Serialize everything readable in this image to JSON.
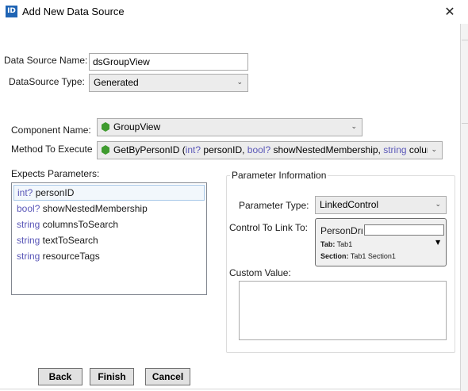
{
  "window": {
    "icon_text": "ID",
    "title": "Add New Data Source",
    "close_glyph": "✕"
  },
  "fields": {
    "data_source_name_label": "Data Source Name:",
    "data_source_name_value": "dsGroupView",
    "datasource_type_label": "DataSource Type:",
    "datasource_type_value": "Generated",
    "component_name_label": "Component Name:",
    "component_name_value": "GroupView",
    "method_label": "Method To Execute",
    "method_name": "GetByPersonID",
    "method_sig_open": " (",
    "method_p1_type": "int?",
    "method_p1_name": " personID, ",
    "method_p2_type": "bool?",
    "method_p2_name": " showNestedMembership, ",
    "method_p3_type": "string",
    "method_p3_name": " colur"
  },
  "expects_parameters": {
    "label": "Expects Parameters:",
    "items": [
      {
        "type": "int?",
        "name": " personID"
      },
      {
        "type": "bool?",
        "name": " showNestedMembership"
      },
      {
        "type": "string",
        "name": " columnsToSearch"
      },
      {
        "type": "string",
        "name": " textToSearch"
      },
      {
        "type": "string",
        "name": " resourceTags"
      }
    ]
  },
  "parameter_info": {
    "legend": "Parameter Information",
    "param_type_label": "Parameter Type:",
    "param_type_value": "LinkedControl",
    "control_link_label": "Control To Link To:",
    "control_name": "PersonDrı",
    "tab_key": "Tab:",
    "tab_value": " Tab1",
    "section_key": "Section:",
    "section_value": " Tab1 Section1",
    "custom_value_label": "Custom Value:"
  },
  "buttons": {
    "back": "Back",
    "finish": "Finish",
    "cancel": "Cancel"
  },
  "icons": {
    "chevron": "⌄",
    "dropdown_arrow": "▼"
  },
  "colors": {
    "keyword": "#5a57b8",
    "method_icon": "#3f9b2f",
    "app_icon": "#1f64b4"
  }
}
